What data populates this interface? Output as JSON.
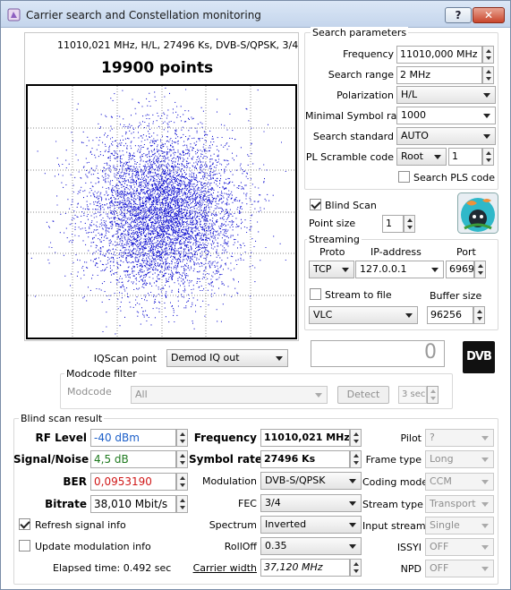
{
  "window": {
    "title": "Carrier search and Constellation monitoring",
    "help": "?",
    "close": "✕"
  },
  "plot": {
    "header": "11010,021 MHz, H/L, 27496 Ks, DVB-S/QPSK, 3/4",
    "points_label": "19900 points",
    "point_count": 19900,
    "point_color": "#1010d0"
  },
  "search": {
    "group_title": "Search parameters",
    "frequency_label": "Frequency",
    "frequency_value": "11010,000 MHz",
    "range_label": "Search range",
    "range_value": "2 MHz",
    "polarization_label": "Polarization",
    "polarization_value": "H/L",
    "min_sr_label": "Minimal Symbol rate",
    "min_sr_value": "1000",
    "standard_label": "Search standard",
    "standard_value": "AUTO",
    "pls_label": "PL Scramble code",
    "pls_mode": "Root",
    "pls_value": "1",
    "search_pls_label": "Search PLS code"
  },
  "blind": {
    "label": "Blind Scan",
    "point_size_label": "Point size",
    "point_size_value": "1"
  },
  "streaming": {
    "group_title": "Streaming",
    "proto_label": "Proto",
    "proto_value": "TCP",
    "ip_label": "IP-address",
    "ip_value": "127.0.0.1",
    "port_label": "Port",
    "port_value": "6969",
    "to_file_label": "Stream to file",
    "buffer_label": "Buffer size",
    "buffer_value": "96256",
    "player_value": "VLC"
  },
  "iqscan": {
    "label": "IQScan point",
    "value": "Demod IQ out",
    "display_value": "0"
  },
  "logo": {
    "text": "DVB"
  },
  "modcode": {
    "group_title": "Modcode filter",
    "label": "Modcode",
    "value": "All",
    "detect_label": "Detect",
    "interval_value": "3 sec"
  },
  "result": {
    "group_title": "Blind scan result",
    "rf_level_label": "RF Level",
    "rf_level_value": "-40 dBm",
    "snr_label": "Signal/Noise",
    "snr_value": "4,5 dB",
    "ber_label": "BER",
    "ber_value": "0,0953190",
    "bitrate_label": "Bitrate",
    "bitrate_value": "38,010 Mbit/s",
    "refresh_label": "Refresh signal info",
    "update_mod_label": "Update modulation info",
    "elapsed_label": "Elapsed time: 0.492 sec",
    "frequency_label": "Frequency",
    "frequency_value": "11010,021 MHz",
    "sr_label": "Symbol rate",
    "sr_value": "27496 Ks",
    "modulation_label": "Modulation",
    "modulation_value": "DVB-S/QPSK",
    "fec_label": "FEC",
    "fec_value": "3/4",
    "spectrum_label": "Spectrum",
    "spectrum_value": "Inverted",
    "rolloff_label": "RollOff",
    "rolloff_value": "0.35",
    "carrier_width_label": "Carrier width",
    "carrier_width_value": "37,120 MHz",
    "pilot_label": "Pilot",
    "pilot_value": "?",
    "frame_label": "Frame type",
    "frame_value": "Long",
    "coding_label": "Coding mode",
    "coding_value": "CCM",
    "stream_type_label": "Stream type",
    "stream_type_value": "Transport",
    "input_stream_label": "Input stream",
    "input_stream_value": "Single",
    "issyi_label": "ISSYI",
    "issyi_value": "OFF",
    "npd_label": "NPD",
    "npd_value": "OFF"
  },
  "colors": {
    "rf_level": "#1c5fc9",
    "snr": "#1f7a1f",
    "ber": "#d01818"
  }
}
